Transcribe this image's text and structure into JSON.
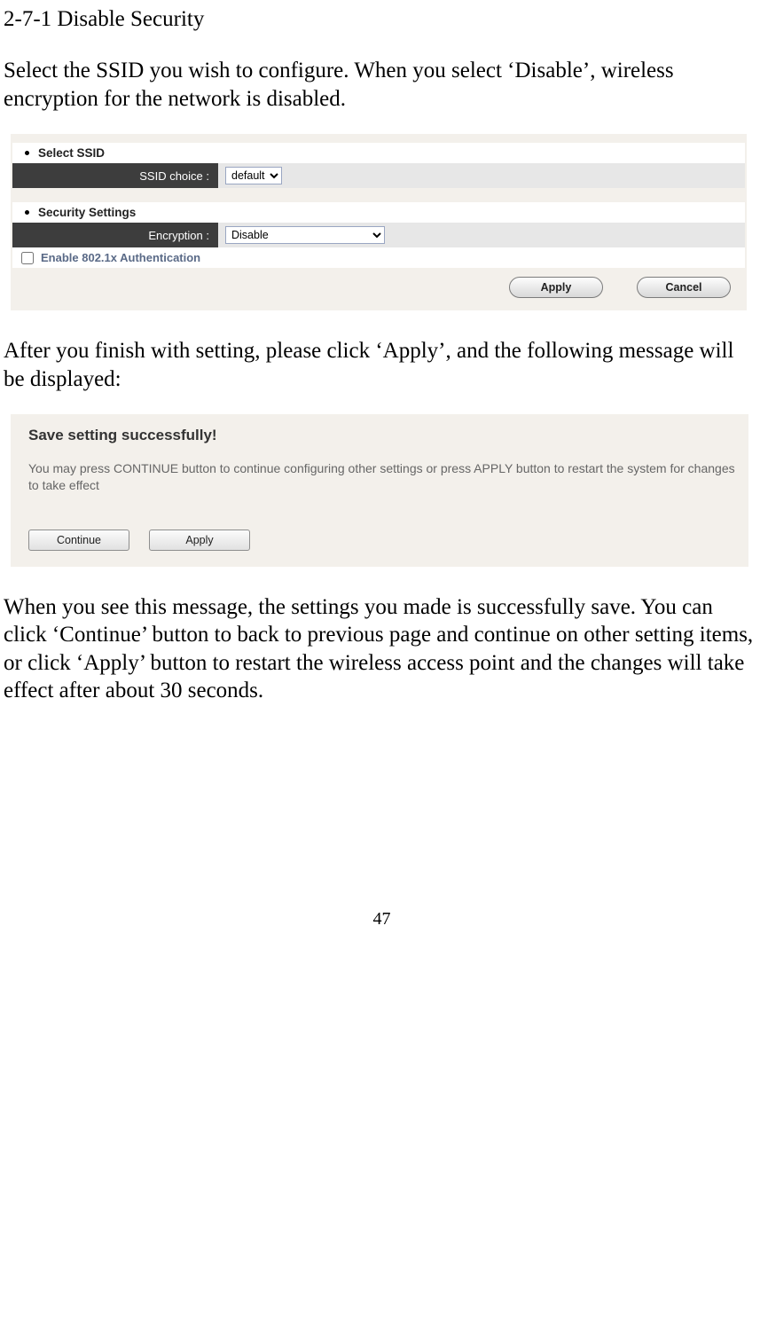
{
  "doc": {
    "section_number": "2-7-1 Disable Security",
    "para1": "Select the SSID you wish to configure. When you select ‘Disable’, wireless encryption for the network is disabled.",
    "para2": "After you finish with setting, please click ‘Apply’, and the following message will be displayed:",
    "para3": "When you see this message, the settings you made is successfully save. You can click ‘Continue’ button to back to previous page and continue on other setting items, or click ‘Apply’ button to restart the wireless access point and the changes will take effect after about 30 seconds.",
    "page_number": "47"
  },
  "panel1": {
    "select_ssid_label": "Select SSID",
    "ssid_choice_label": "SSID choice :",
    "ssid_choice_value": "default",
    "security_settings_label": "Security Settings",
    "encryption_label": "Encryption :",
    "encryption_value": "Disable",
    "enable_8021x_label": "Enable 802.1x Authentication",
    "apply_label": "Apply",
    "cancel_label": "Cancel"
  },
  "panel2": {
    "title": "Save setting successfully!",
    "message": "You may press CONTINUE button to continue configuring other settings or press APPLY button to restart the system for changes to take effect",
    "continue_label": "Continue",
    "apply_label": "Apply"
  }
}
